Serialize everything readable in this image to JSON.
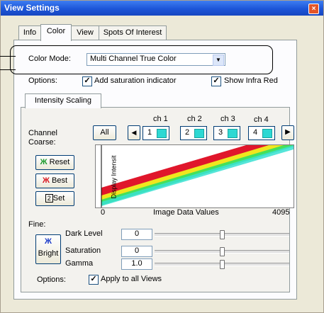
{
  "window": {
    "title": "View Settings",
    "close_glyph": "×"
  },
  "tabs": [
    {
      "label": "Info"
    },
    {
      "label": "Color"
    },
    {
      "label": "View"
    },
    {
      "label": "Spots Of Interest"
    }
  ],
  "color_mode": {
    "label": "Color Mode:",
    "value": "Multi Channel True Color"
  },
  "options_row": {
    "label": "Options:",
    "saturation": {
      "label": "Add saturation indicator",
      "checked": true
    },
    "infra_red": {
      "label": "Show Infra Red",
      "checked": true
    }
  },
  "subtab": {
    "label": "Intensity Scaling"
  },
  "channel": {
    "label": "Channel",
    "all_label": "All",
    "prev_icon": "left-arrow-icon",
    "next_icon": "right-arrow-icon",
    "channels": [
      {
        "header": "ch 1",
        "num": "1",
        "color": "#2dd8d3"
      },
      {
        "header": "ch 2",
        "num": "2",
        "color": "#2dd8d3"
      },
      {
        "header": "ch 3",
        "num": "3",
        "color": "#2dd8d3"
      },
      {
        "header": "ch 4",
        "num": "4",
        "color": "#2dd8d3"
      }
    ]
  },
  "coarse": {
    "label": "Coarse:",
    "reset": "Reset",
    "best": "Best",
    "set": "Set"
  },
  "plot": {
    "ylabel": "Display Intensit",
    "xlabel": "Image Data Values",
    "xmin": "0",
    "xmax": "4095",
    "line_colors": [
      "#e0162b",
      "#f0e61e",
      "#45e05a",
      "#38e0d2"
    ]
  },
  "fine": {
    "label": "Fine:",
    "bright": "Bright",
    "dark_level": {
      "label": "Dark Level",
      "value": "0",
      "position": 0.5
    },
    "saturation": {
      "label": "Saturation",
      "value": "0",
      "position": 0.5
    },
    "gamma": {
      "label": "Gamma",
      "value": "1.0",
      "position": 0.5
    }
  },
  "bottom_options": {
    "label": "Options:",
    "apply_all": {
      "label": "Apply to all Views",
      "checked": true
    }
  }
}
